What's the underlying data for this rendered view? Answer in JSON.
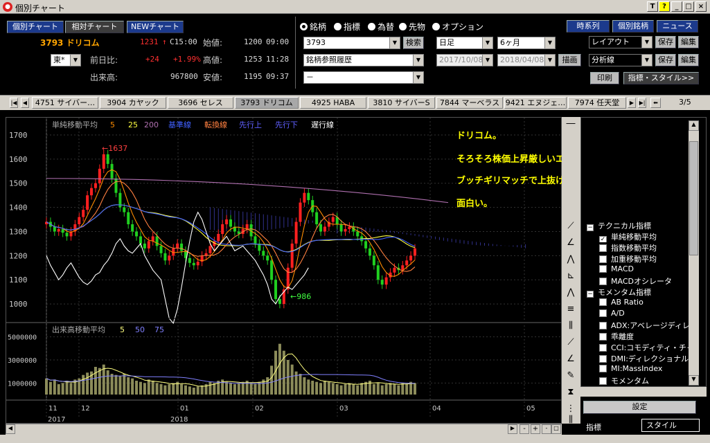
{
  "window": {
    "title": "個別チャート",
    "buttons": [
      "T",
      "?",
      "_",
      "□",
      "×"
    ]
  },
  "header": {
    "mode_tabs": [
      "個別チャート",
      "相対チャート",
      "NEWチャート"
    ],
    "stock_code_name": "3793 ドリコム",
    "price": "1231",
    "price_mark": "↑",
    "price_time": "C15:00",
    "market": "東*",
    "prev_diff_label": "前日比:",
    "prev_diff": "+24",
    "prev_diff_pct": "+1.99%",
    "volume_label": "出来高:",
    "volume": "967800",
    "open_label": "始値:",
    "open_value": "1200",
    "open_time": "09:00",
    "high_label": "高値:",
    "high_value": "1253",
    "high_time": "11:28",
    "low_label": "安値:",
    "low_value": "1195",
    "low_time": "09:37"
  },
  "type_radios": {
    "options": [
      "銘柄",
      "指標",
      "為替",
      "先物",
      "オプション"
    ],
    "selected": "銘柄"
  },
  "search": {
    "code_value": "3793",
    "search_button": "検索",
    "history_value": "銘柄参照履歴",
    "dash_value": "－"
  },
  "period": {
    "interval": "日足",
    "span": "6ヶ月",
    "from": "2017/10/08",
    "to": "2018/04/08",
    "draw_button": "描画"
  },
  "right_buttons": {
    "timeseries": "時系列",
    "individual": "個別銘柄",
    "news": "ニュース",
    "layout": "レイアウト",
    "save": "保存",
    "edit": "編集",
    "analysis": "分析線",
    "print": "印刷",
    "indicator_style": "指標・スタイル>>"
  },
  "stock_tabs": {
    "items": [
      "4751 サイバー…",
      "3904 カヤック",
      "3696 セレス",
      "3793 ドリコム",
      "4925 HABA",
      "3810 サイバーS",
      "7844 マーベラス",
      "9421 エヌジェ…",
      "7974 任天堂"
    ],
    "active": "3793 ドリコム",
    "page": "3/5"
  },
  "chart_legend": {
    "title": "単純移動平均",
    "periods": [
      "5",
      "25",
      "200"
    ],
    "lines": [
      "基準線",
      "転換線",
      "先行上",
      "先行下",
      "遅行線"
    ],
    "volume_title": "出来高移動平均",
    "volume_periods": [
      "5",
      "50",
      "75"
    ]
  },
  "annotations": {
    "line1": "ドリコム。",
    "line2": "そろそろ株価上昇厳しいエリアに。",
    "line3": "ブッチギリマッチで上抜ければ",
    "line4": "面白い。",
    "peak": "←1637",
    "trough": "←986"
  },
  "indicator_tree": {
    "items": [
      {
        "label": "テクニカル指標",
        "type": "group"
      },
      {
        "label": "単純移動平均",
        "checked": true
      },
      {
        "label": "指数移動平均",
        "checked": false
      },
      {
        "label": "加重移動平均",
        "checked": false
      },
      {
        "label": "MACD",
        "checked": false
      },
      {
        "label": "MACDオシレータ",
        "checked": false
      },
      {
        "label": "モメンタム指標",
        "type": "group"
      },
      {
        "label": "AB Ratio",
        "checked": false
      },
      {
        "label": "A/D",
        "checked": false
      },
      {
        "label": "ADX:アベレージディレ",
        "checked": false
      },
      {
        "label": "乖離度",
        "checked": false
      },
      {
        "label": "CCI:コモディティ・チャ",
        "checked": false
      },
      {
        "label": "DMI:ディレクショナル",
        "checked": false
      },
      {
        "label": "MI:MassIndex",
        "checked": false
      },
      {
        "label": "モメンタム",
        "checked": false
      }
    ],
    "settings_button": "設定",
    "bottom_tabs": [
      "指標",
      "スタイル"
    ]
  },
  "chart_data": {
    "type": "line",
    "price_axis": {
      "ticks": [
        1000,
        1100,
        1200,
        1300,
        1400,
        1500,
        1600,
        1700
      ],
      "ylim": [
        940,
        1720
      ]
    },
    "volume_axis": {
      "ticks": [
        1000000,
        3000000,
        5000000
      ],
      "labels": [
        "1000000",
        "3000000",
        "5000000"
      ],
      "ylim": [
        0,
        6000000
      ]
    },
    "x_labels": [
      "11",
      "12",
      "01",
      "02",
      "03",
      "04",
      "05"
    ],
    "year_labels": [
      "2017",
      "2018"
    ],
    "close": [
      1340,
      1320,
      1300,
      1310,
      1295,
      1280,
      1300,
      1330,
      1360,
      1390,
      1450,
      1480,
      1500,
      1560,
      1620,
      1580,
      1520,
      1460,
      1400,
      1380,
      1330,
      1300,
      1280,
      1250,
      1230,
      1260,
      1280,
      1240,
      1210,
      1180,
      1200,
      1230,
      1250,
      1220,
      1190,
      1170,
      1160,
      1175,
      1200,
      1210,
      1240,
      1260,
      1290,
      1330,
      1350,
      1320,
      1300,
      1290,
      1310,
      1330,
      1280,
      1250,
      1220,
      1200,
      1180,
      1100,
      1020,
      1000,
      1060,
      1150,
      1250,
      1340,
      1420,
      1460,
      1430,
      1380,
      1330,
      1300,
      1320,
      1340,
      1360,
      1330,
      1300,
      1310,
      1320,
      1300,
      1280,
      1260,
      1230,
      1200,
      1160,
      1100,
      1080,
      1110,
      1130,
      1150,
      1140,
      1160,
      1180,
      1200,
      1230
    ],
    "volume": [
      1400000,
      1100000,
      1300000,
      900000,
      1000000,
      1200000,
      1000000,
      1300000,
      1400000,
      1700000,
      1900000,
      2000000,
      2400000,
      2300000,
      2600000,
      2100000,
      1800000,
      1700000,
      1600000,
      1800000,
      1500000,
      1400000,
      1200000,
      1100000,
      1000000,
      1300000,
      1200000,
      1000000,
      900000,
      800000,
      900000,
      1000000,
      1100000,
      900000,
      800000,
      700000,
      600000,
      700000,
      800000,
      900000,
      1100000,
      1000000,
      1200000,
      1300000,
      1100000,
      1000000,
      900000,
      1000000,
      1100000,
      1200000,
      1000000,
      900000,
      1100000,
      1300000,
      1500000,
      2500000,
      3800000,
      4400000,
      3800000,
      3000000,
      2600000,
      2000000,
      1800000,
      1500000,
      1300000,
      1200000,
      1100000,
      1000000,
      1200000,
      1100000,
      1000000,
      900000,
      800000,
      900000,
      1000000,
      900000,
      800000,
      1000000,
      1100000,
      1200000,
      900000,
      1000000,
      800000,
      900000,
      1000000,
      900000,
      800000,
      1000000,
      900000,
      1100000,
      1000000
    ],
    "colors": {
      "up": "#ff2020",
      "down": "#20d020",
      "sma5": "#ff8c00",
      "sma25": "#ffff40",
      "sma200": "#b070b0",
      "kijun": "#4060ff",
      "tenkan": "#ff8040",
      "senkou_a": "#6060ff",
      "chikou": "#ffffff",
      "volume": "#8c8c5a"
    }
  }
}
